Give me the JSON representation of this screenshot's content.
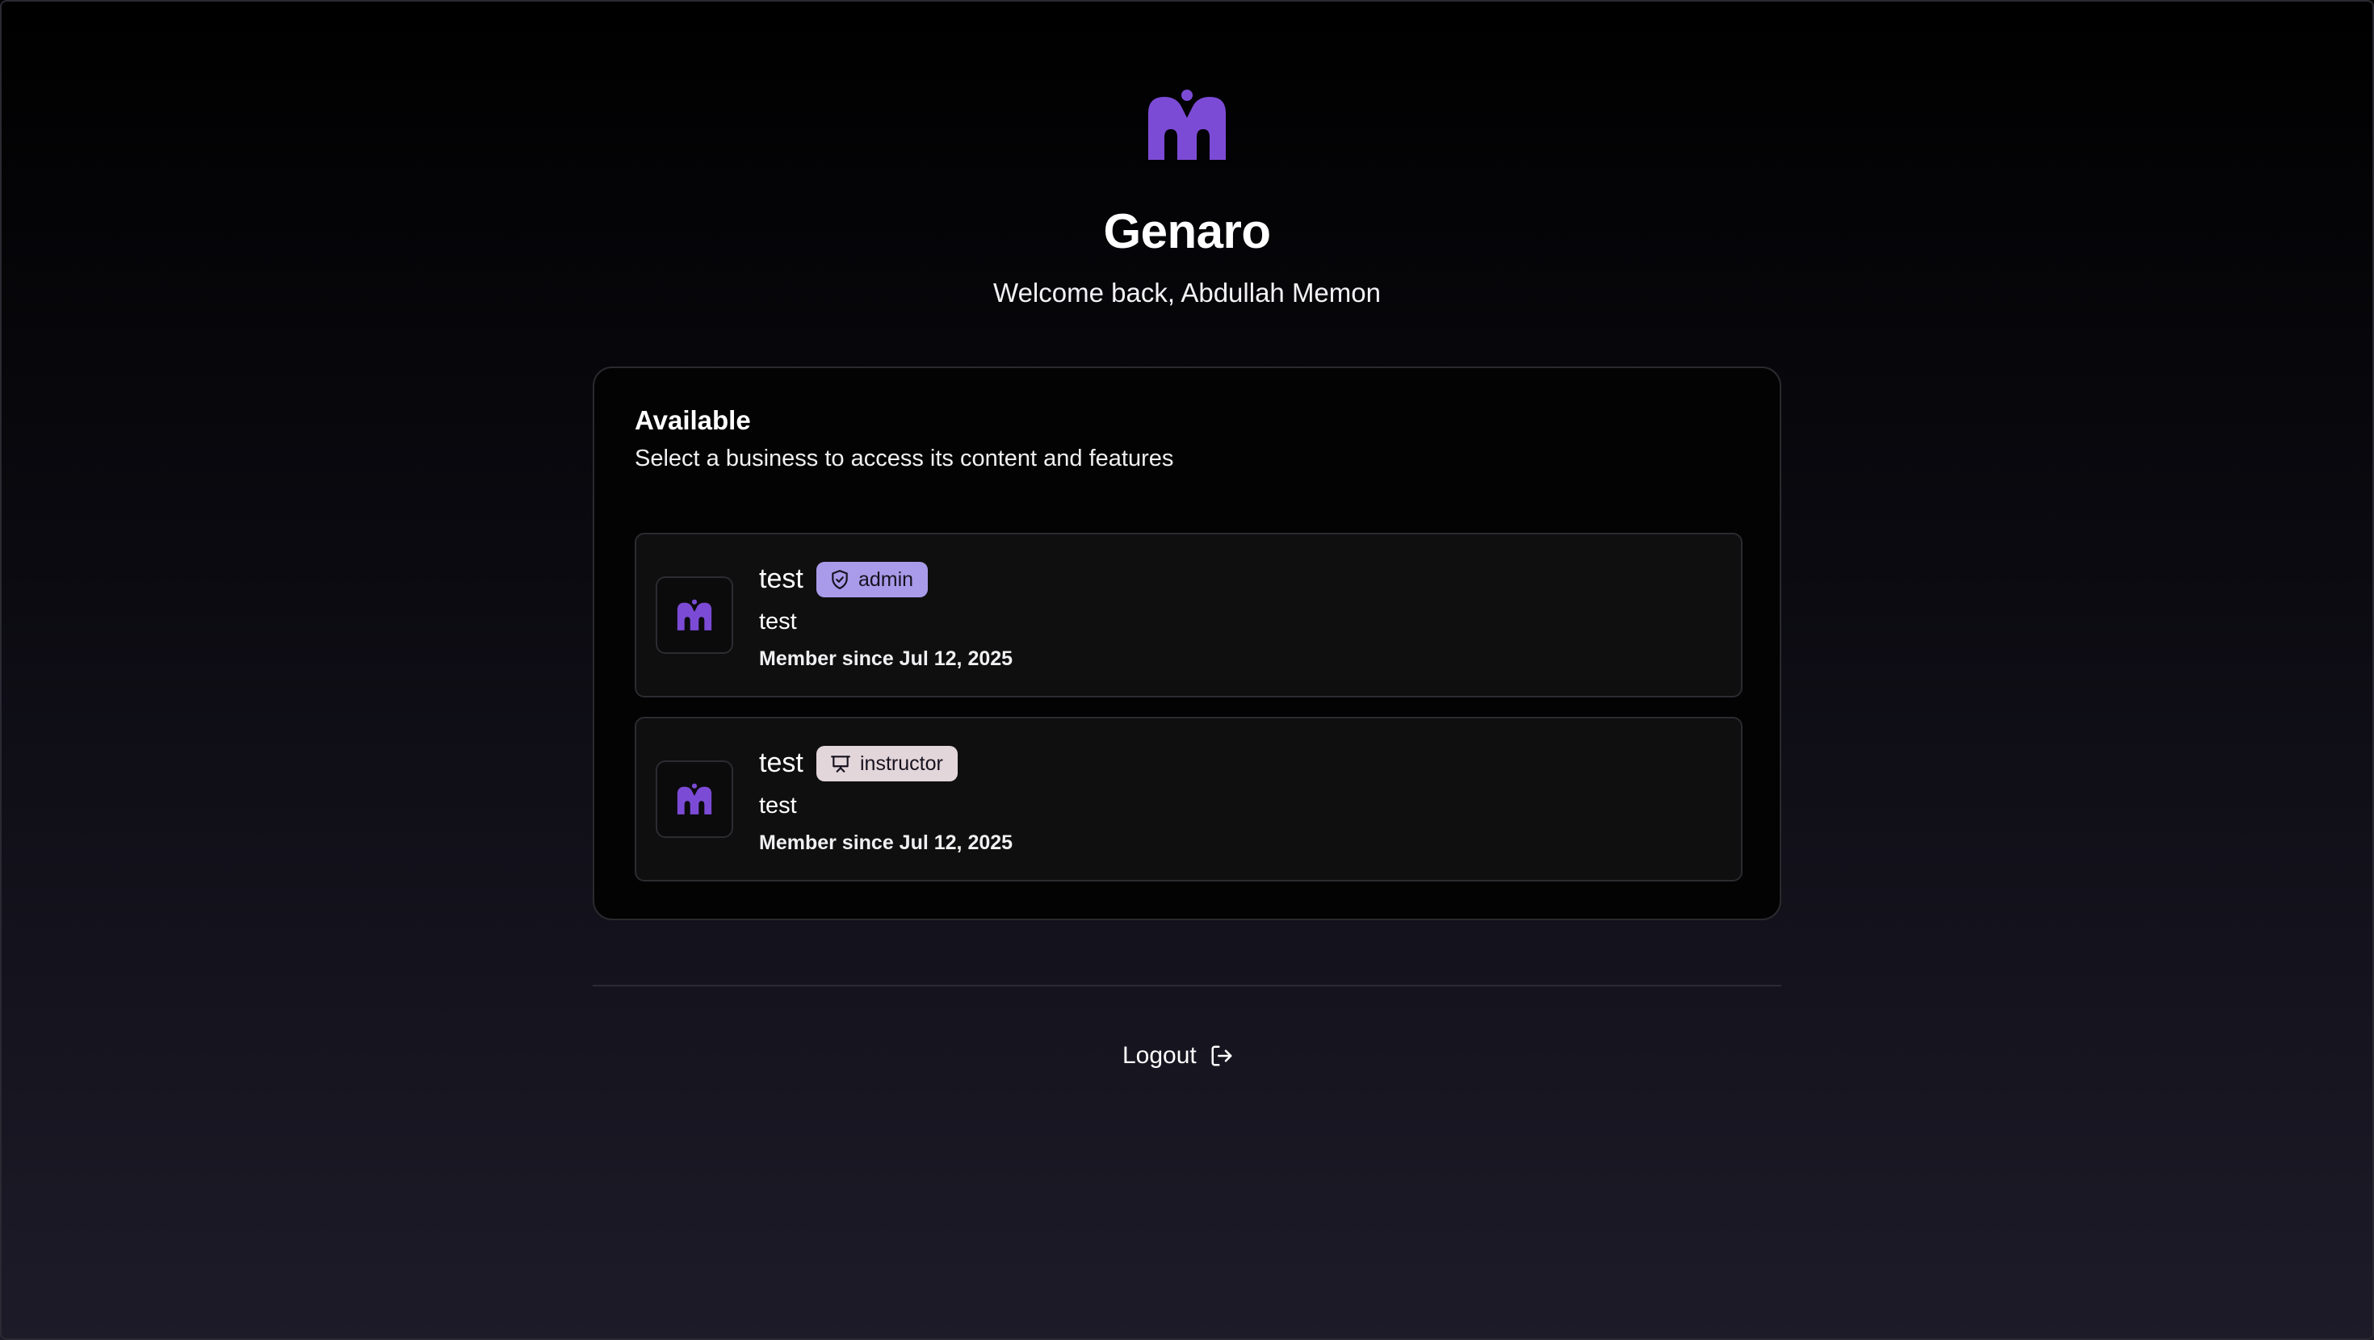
{
  "app": {
    "title": "Genaro",
    "welcome": "Welcome back, Abdullah Memon",
    "brand_color": "#7c4bd6"
  },
  "card": {
    "title": "Available",
    "subtitle": "Select a business to access its content and features"
  },
  "businesses": [
    {
      "name": "test",
      "role": "admin",
      "role_icon": "shield-check-icon",
      "role_color": "#a99bea",
      "description": "test",
      "member_since": "Member since Jul 12, 2025"
    },
    {
      "name": "test",
      "role": "instructor",
      "role_icon": "presentation-icon",
      "role_color": "#e3d6da",
      "description": "test",
      "member_since": "Member since Jul 12, 2025"
    }
  ],
  "logout": {
    "label": "Logout",
    "icon": "logout-arrow-icon"
  }
}
